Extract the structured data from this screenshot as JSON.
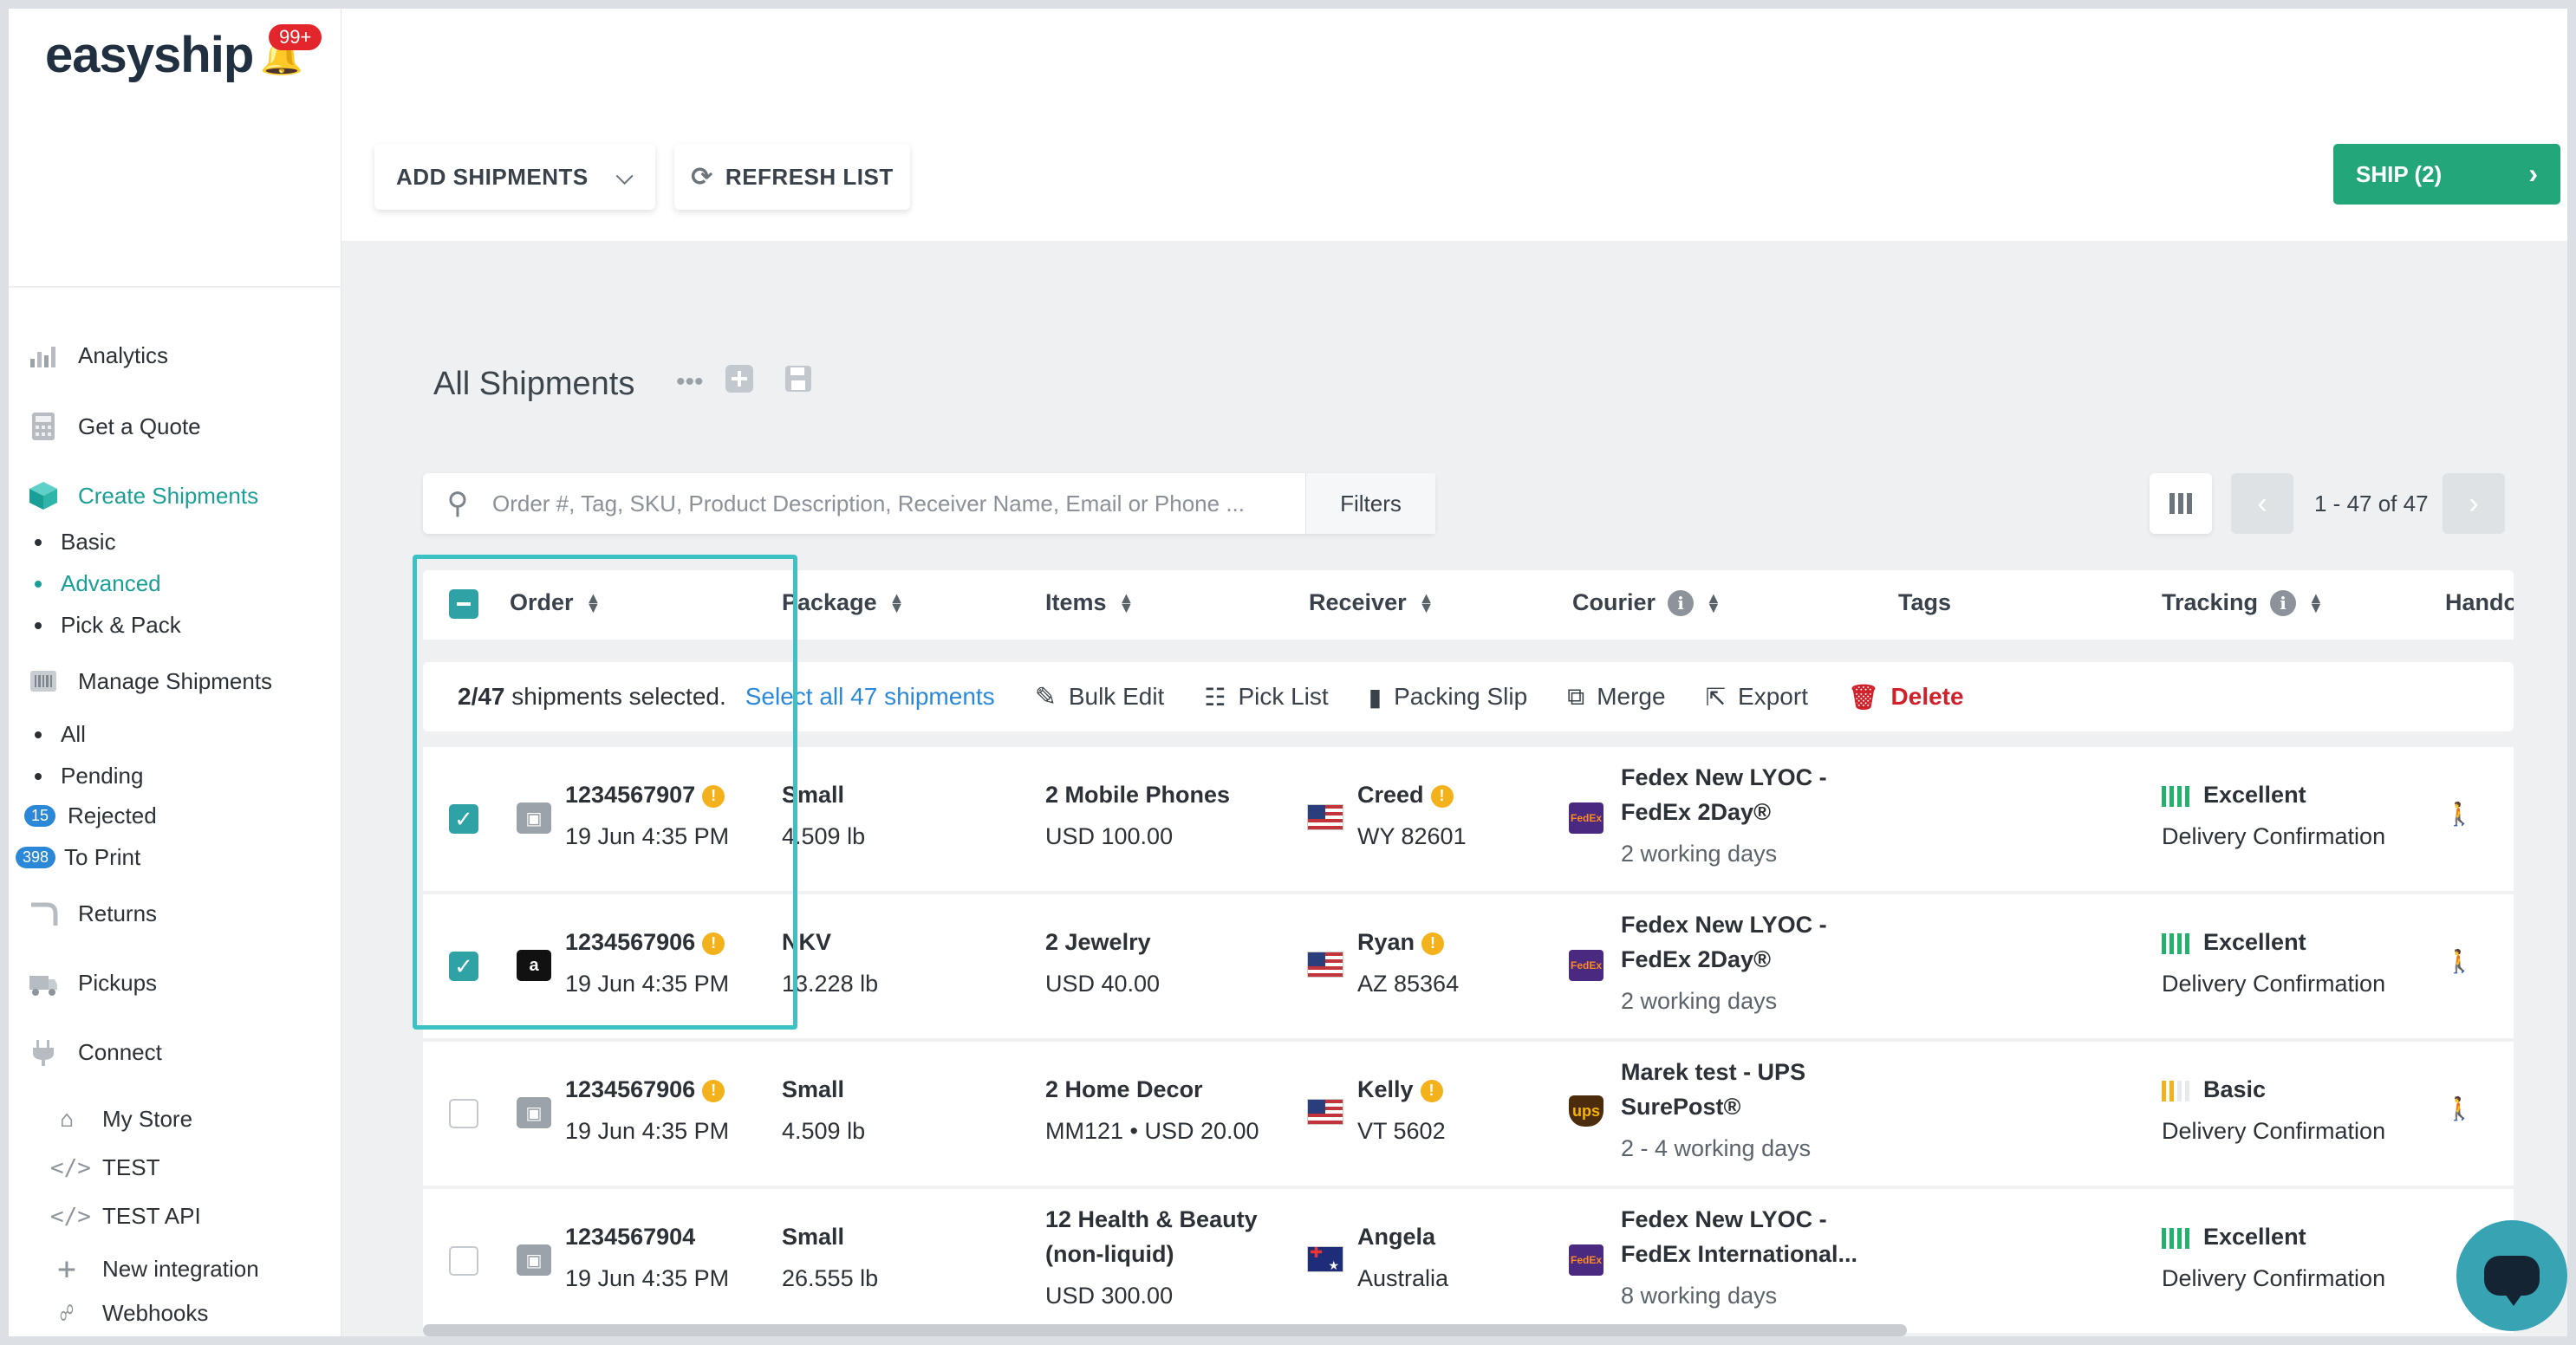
{
  "app": {
    "logo": "easyship",
    "notification_badge": "99+"
  },
  "sidebar": {
    "nav": [
      {
        "label": "Analytics",
        "icon": "analytics-icon"
      },
      {
        "label": "Get a Quote",
        "icon": "calculator-icon"
      },
      {
        "label": "Create Shipments",
        "icon": "box-icon",
        "active": true
      }
    ],
    "create_sub": [
      {
        "label": "Basic"
      },
      {
        "label": "Advanced",
        "active": true
      },
      {
        "label": "Pick & Pack"
      }
    ],
    "manage": {
      "label": "Manage Shipments",
      "icon": "barcode-icon"
    },
    "manage_sub": [
      {
        "label": "All"
      },
      {
        "label": "Pending"
      },
      {
        "label": "Rejected",
        "count": "15"
      },
      {
        "label": "To Print",
        "count": "398"
      }
    ],
    "returns": "Returns",
    "pickups": "Pickups",
    "connect": "Connect",
    "connect_sub": [
      {
        "label": "My Store",
        "icon": "store-icon"
      },
      {
        "label": "TEST",
        "icon": "code-icon",
        "glyph": "</>"
      },
      {
        "label": "TEST API",
        "icon": "code-icon",
        "glyph": "</>"
      },
      {
        "label": "New integration",
        "icon": "plus-icon",
        "glyph": "+"
      },
      {
        "label": "Webhooks",
        "icon": "webhook-icon"
      }
    ]
  },
  "toolbar": {
    "add_shipments": "ADD SHIPMENTS",
    "refresh_list": "REFRESH LIST",
    "ship": "SHIP (2)"
  },
  "page": {
    "title": "All Shipments",
    "search_placeholder": "Order #, Tag, SKU, Product Description, Receiver Name, Email or Phone ...",
    "filters": "Filters",
    "pagination": "1 - 47 of 47"
  },
  "table": {
    "headers": [
      "Order",
      "Package",
      "Items",
      "Receiver",
      "Courier",
      "Tags",
      "Tracking",
      "Hando"
    ],
    "bulk": {
      "selected_count": "2/47",
      "selected_text": "shipments selected.",
      "select_all": "Select all 47 shipments",
      "actions": [
        {
          "label": "Bulk Edit",
          "icon": "pencil-icon"
        },
        {
          "label": "Pick List",
          "icon": "list-icon"
        },
        {
          "label": "Packing Slip",
          "icon": "document-icon"
        },
        {
          "label": "Merge",
          "icon": "merge-icon"
        },
        {
          "label": "Export",
          "icon": "export-icon"
        },
        {
          "label": "Delete",
          "icon": "trash-icon"
        }
      ]
    },
    "rows": [
      {
        "checked": true,
        "store": "store-icon",
        "order": "1234567907",
        "date": "19 Jun 4:35 PM",
        "package": "Small",
        "weight": "4.509 lb",
        "items": [
          "2 Mobile Phones"
        ],
        "items_value": "USD 100.00",
        "receiver": "Creed",
        "receiver_loc": "WY 82601",
        "flag": "us",
        "courier": [
          "Fedex New LYOC -",
          "FedEx 2Day®"
        ],
        "courier_logo": "fedex-logo",
        "eta": "2 working days",
        "tracking": "Excellent",
        "tracking_sub": "Delivery Confirmation",
        "tracking_level": 4
      },
      {
        "checked": true,
        "store": "amazon-icon",
        "order": "1234567906",
        "date": "19 Jun 4:35 PM",
        "package": "NKV",
        "weight": "13.228 lb",
        "items": [
          "2 Jewelry"
        ],
        "items_value": "USD 40.00",
        "receiver": "Ryan",
        "receiver_loc": "AZ 85364",
        "flag": "us",
        "courier": [
          "Fedex New LYOC -",
          "FedEx 2Day®"
        ],
        "courier_logo": "fedex-logo",
        "eta": "2 working days",
        "tracking": "Excellent",
        "tracking_sub": "Delivery Confirmation",
        "tracking_level": 4
      },
      {
        "checked": false,
        "store": "store-icon",
        "order": "1234567906",
        "date": "19 Jun 4:35 PM",
        "package": "Small",
        "weight": "4.509 lb",
        "items": [
          "2 Home Decor"
        ],
        "items_value": "MM121 • USD 20.00",
        "receiver": "Kelly",
        "receiver_loc": "VT 5602",
        "flag": "us",
        "courier": [
          "Marek test - UPS",
          "SurePost®"
        ],
        "courier_logo": "ups-logo",
        "eta": "2 - 4 working days",
        "tracking": "Basic",
        "tracking_sub": "Delivery Confirmation",
        "tracking_level": 2
      },
      {
        "checked": false,
        "store": "store-icon",
        "order": "1234567904",
        "date": "19 Jun 4:35 PM",
        "package": "Small",
        "weight": "26.555 lb",
        "items": [
          "12 Health & Beauty",
          "(non-liquid)"
        ],
        "items_value": "USD 300.00",
        "receiver": "Angela",
        "receiver_loc": "Australia",
        "flag": "au",
        "courier": [
          "Fedex New LYOC -",
          "FedEx International..."
        ],
        "courier_logo": "fedex-logo",
        "eta": "8 working days",
        "tracking": "Excellent",
        "tracking_sub": "Delivery Confirmation",
        "tracking_level": 4
      }
    ]
  },
  "colors": {
    "brand": "#1a9f96",
    "ship_button": "#23a77a",
    "selection": "#3cc1c4",
    "delete": "#d0202a",
    "link": "#2b88d8"
  }
}
